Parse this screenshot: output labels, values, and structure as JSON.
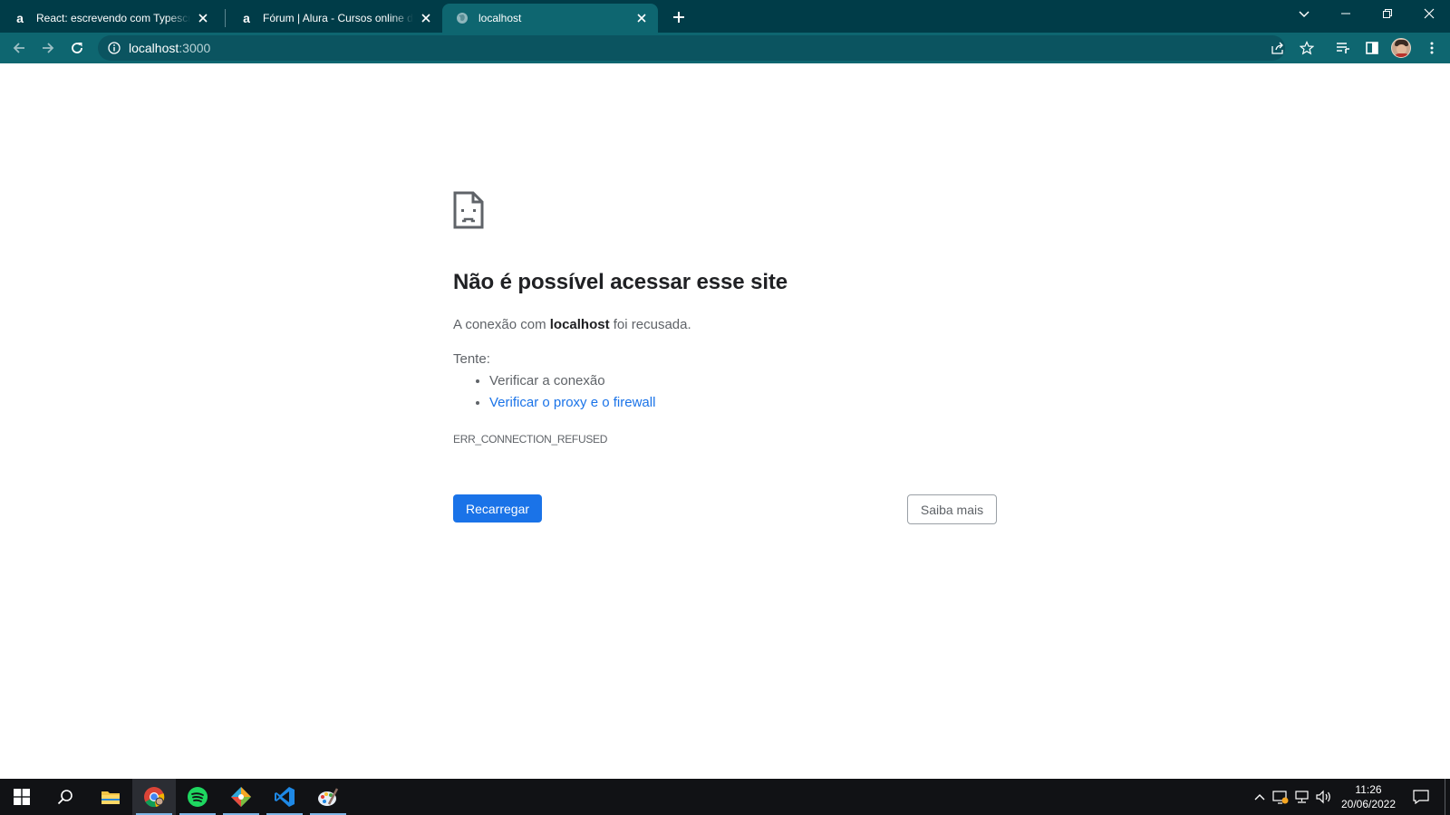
{
  "browser": {
    "tabs": [
      {
        "title": "React: escrevendo com Typescrip",
        "favicon": "alura-a-icon",
        "favicon_glyph": "a",
        "active": false
      },
      {
        "title": "Fórum | Alura - Cursos online de",
        "favicon": "alura-a-icon",
        "favicon_glyph": "a",
        "active": false
      },
      {
        "title": "localhost",
        "favicon": "globe-icon",
        "active": true
      }
    ],
    "address": {
      "host": "localhost",
      "port": ":3000"
    },
    "colors": {
      "tabstrip": "#003c48",
      "toolbar": "#0e6670"
    }
  },
  "page": {
    "title": "Não é possível acessar esse site",
    "desc_prefix": "A conexão com ",
    "desc_host": "localhost",
    "desc_suffix": " foi recusada.",
    "try_label": "Tente:",
    "suggestions": [
      {
        "text": "Verificar a conexão",
        "link": false
      },
      {
        "text": "Verificar o proxy e o firewall",
        "link": true
      }
    ],
    "error_code": "ERR_CONNECTION_REFUSED",
    "reload_button": "Recarregar",
    "details_button": "Saiba mais",
    "colors": {
      "primary": "#1a73e8",
      "link": "#1a73e8"
    }
  },
  "taskbar": {
    "apps": [
      "windows-start-icon",
      "search-icon",
      "file-explorer-icon",
      "chrome-icon",
      "spotify-icon",
      "git-kraken-icon",
      "vscode-icon",
      "paint-icon"
    ],
    "clock_time": "11:26",
    "clock_date": "20/06/2022"
  }
}
